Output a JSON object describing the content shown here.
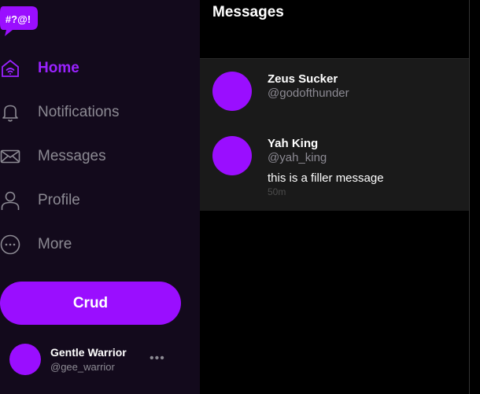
{
  "app": {
    "logo_text": "#?@!",
    "brand_color": "#9a0eff"
  },
  "sidebar": {
    "items": [
      {
        "label": "Home",
        "icon": "home-icon",
        "active": true
      },
      {
        "label": "Notifications",
        "icon": "bell-icon",
        "active": false
      },
      {
        "label": "Messages",
        "icon": "envelope-icon",
        "active": false
      },
      {
        "label": "Profile",
        "icon": "user-icon",
        "active": false
      },
      {
        "label": "More",
        "icon": "more-circle-icon",
        "active": false
      }
    ],
    "post_button_label": "Crud"
  },
  "account": {
    "name": "Gentle Warrior",
    "handle": "@gee_warrior",
    "menu_glyph": "•••"
  },
  "main": {
    "title": "Messages",
    "messages": [
      {
        "name": "Zeus Sucker",
        "handle": "@godofthunder",
        "text": "",
        "time": ""
      },
      {
        "name": "Yah King",
        "handle": "@yah_king",
        "text": "this is a filler message",
        "time": "50m"
      }
    ]
  }
}
